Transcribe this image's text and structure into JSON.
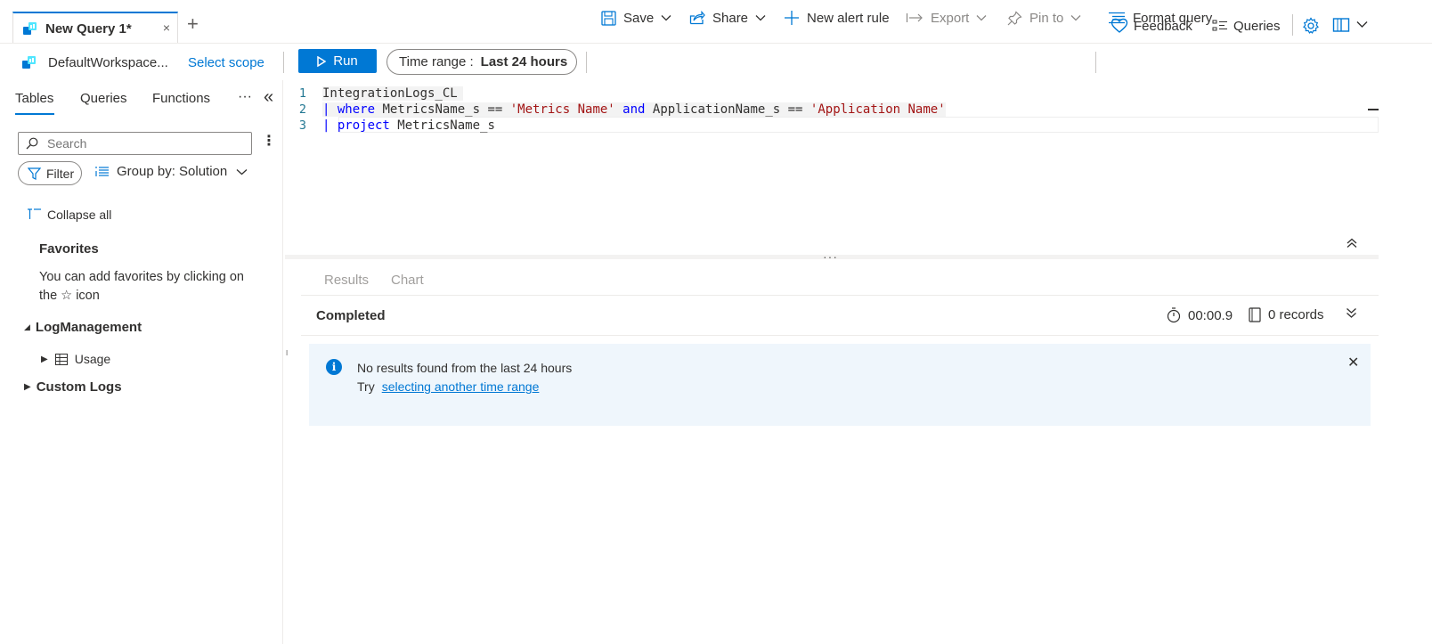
{
  "tab": {
    "title": "New Query 1*",
    "close_glyph": "×",
    "add_glyph": "+"
  },
  "header_right": {
    "feedback_label": "Feedback",
    "queries_label": "Queries"
  },
  "command_bar": {
    "workspace_label": "DefaultWorkspace...",
    "select_scope_label": "Select scope",
    "run_label": "Run",
    "time_range_prefix": "Time range :",
    "time_range_value": "Last 24 hours",
    "save_label": "Save",
    "share_label": "Share",
    "new_alert_label": "New alert rule",
    "export_label": "Export",
    "pin_label": "Pin to",
    "format_label": "Format query"
  },
  "left_panel": {
    "tabs": [
      "Tables",
      "Queries",
      "Functions"
    ],
    "more_glyph": "···",
    "collapse_glyph": "«",
    "search_placeholder": "Search",
    "filter_label": "Filter",
    "group_by_label": "Group by: Solution",
    "collapse_all_label": "Collapse all",
    "favorites_title": "Favorites",
    "favorites_text": "You can add favorites by clicking on the ☆ icon",
    "tree": {
      "log_management": "LogManagement",
      "usage": "Usage",
      "custom_logs": "Custom Logs"
    }
  },
  "editor": {
    "line_numbers": [
      "1",
      "2",
      "3"
    ],
    "line1": "IntegrationLogs_CL",
    "line2_pipe": "| ",
    "line2_kw": "where",
    "line2_a": " MetricsName_s == ",
    "line2_str1": "'Metrics Name'",
    "line2_and": " and",
    "line2_b": " ApplicationName_s == ",
    "line2_str2": "'Application Name'",
    "line3_pipe": "| ",
    "line3_kw": "project",
    "line3_rest": " MetricsName_s"
  },
  "results": {
    "tabs": [
      "Results",
      "Chart"
    ],
    "status": "Completed",
    "duration": "00:00.9",
    "records": "0 records",
    "info_message": "No results found from the last 24 hours",
    "try_label": "Try",
    "try_link": "selecting another time range",
    "close_glyph": "✕"
  },
  "colors": {
    "accent": "#0078d4",
    "info_bg": "#eff6fc",
    "keyword": "#0000ff",
    "string": "#a31515"
  }
}
